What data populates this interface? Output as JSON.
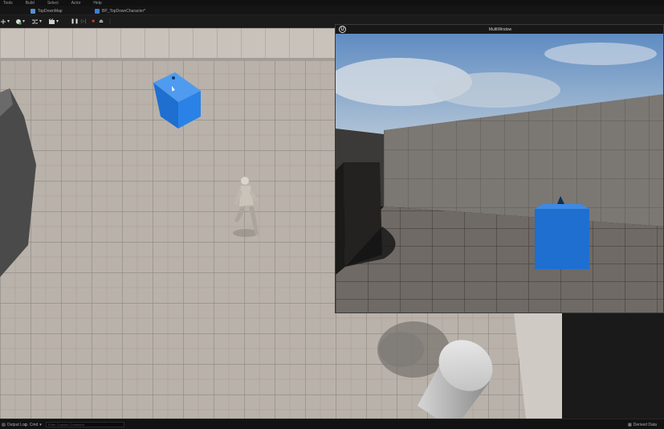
{
  "menu": [
    "Tools",
    "Build",
    "Select",
    "Actor",
    "Help"
  ],
  "tabs": [
    {
      "label": "TopDownMap"
    },
    {
      "label": "BP_TopDownCharacter*"
    }
  ],
  "toolbar": {
    "pause": "❚❚",
    "step": "▷|",
    "stop": "■",
    "eject": "⏏"
  },
  "pie_window": {
    "title": "MultiWindow"
  },
  "statusbar": {
    "output_log": "Output Log",
    "cmd": "Cmd",
    "cmd_placeholder": "Enter Console Command",
    "derived_data": "Derived Data"
  },
  "colors": {
    "accent_blue": "#1f74d6",
    "stop_red": "#d23b2f",
    "floor": "#b7b0a8",
    "sky": "#6f98c7"
  },
  "icons": [
    "unreal-logo-icon",
    "blueprint-icon",
    "pause-icon",
    "step-icon",
    "stop-icon",
    "eject-icon",
    "output-log-icon",
    "derived-data-icon"
  ]
}
